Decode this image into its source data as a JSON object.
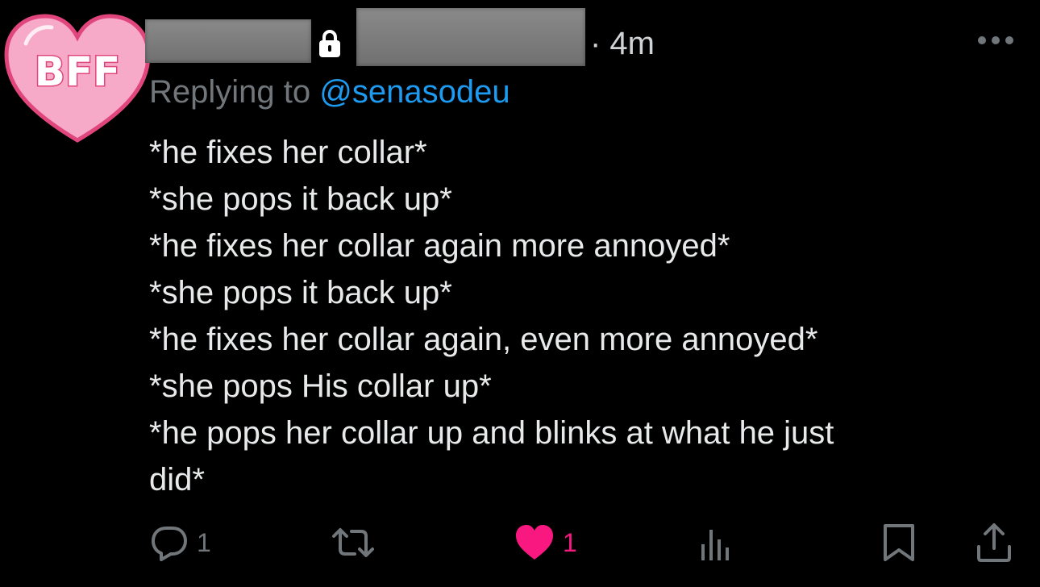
{
  "avatar": {
    "label": "BFF",
    "colors": {
      "heart_fill": "#f7a9c8",
      "heart_stroke": "#e0457b",
      "text_fill": "#ffffff",
      "text_stroke": "#e0457b"
    }
  },
  "header": {
    "timestamp": "· 4m",
    "icons": {
      "lock": "lock-icon",
      "more": "more-icon"
    }
  },
  "reply": {
    "prefix": "Replying to ",
    "handle": "@senasodeu"
  },
  "tweet": {
    "lines": [
      "*he fixes her collar*",
      "*she pops it back up*",
      "*he fixes her collar again more annoyed*",
      "*she pops it back up*",
      "*he fixes her collar again, even more annoyed*",
      "*she pops His collar up*",
      "*he pops her collar up and blinks at what he just",
      "did*"
    ]
  },
  "actions": {
    "reply_count": "1",
    "like_count": "1",
    "icons": [
      "reply-icon",
      "retweet-icon",
      "like-icon",
      "views-icon",
      "bookmark-icon",
      "share-icon"
    ]
  },
  "colors": {
    "background": "#000000",
    "text": "#e7e9ea",
    "muted": "#71767b",
    "link": "#1d9bf0",
    "like": "#f91880"
  }
}
